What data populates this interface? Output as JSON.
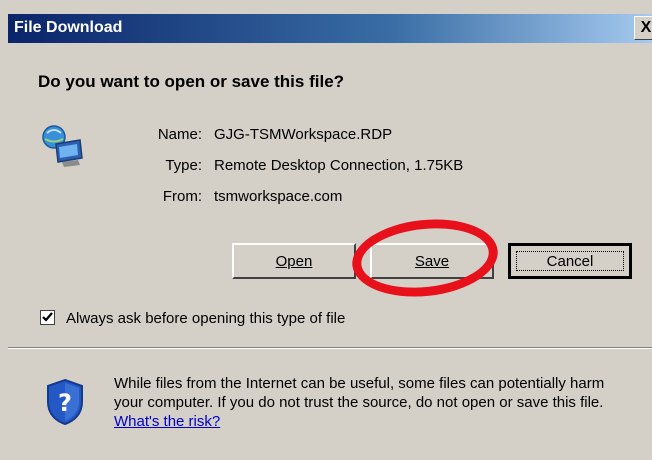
{
  "title": "File Download",
  "close_glyph": "X",
  "question": "Do you want to open or save this file?",
  "file": {
    "name_label": "Name:",
    "name": "GJG-TSMWorkspace.RDP",
    "type_label": "Type:",
    "type": "Remote Desktop Connection, 1.75KB",
    "from_label": "From:",
    "from": "tsmworkspace.com"
  },
  "buttons": {
    "open": "Open",
    "save": "Save",
    "cancel": "Cancel"
  },
  "checkbox": {
    "label": "Always ask before opening this type of file",
    "checked": true
  },
  "warning": {
    "text": "While files from the Internet can be useful, some files can potentially harm your computer. If you do not trust the source, do not open or save this file.",
    "link": "What's the risk?"
  },
  "colors": {
    "annotation": "#e8101a",
    "dialog_bg": "#d4d0c8",
    "titlebar": "#0a246a"
  }
}
